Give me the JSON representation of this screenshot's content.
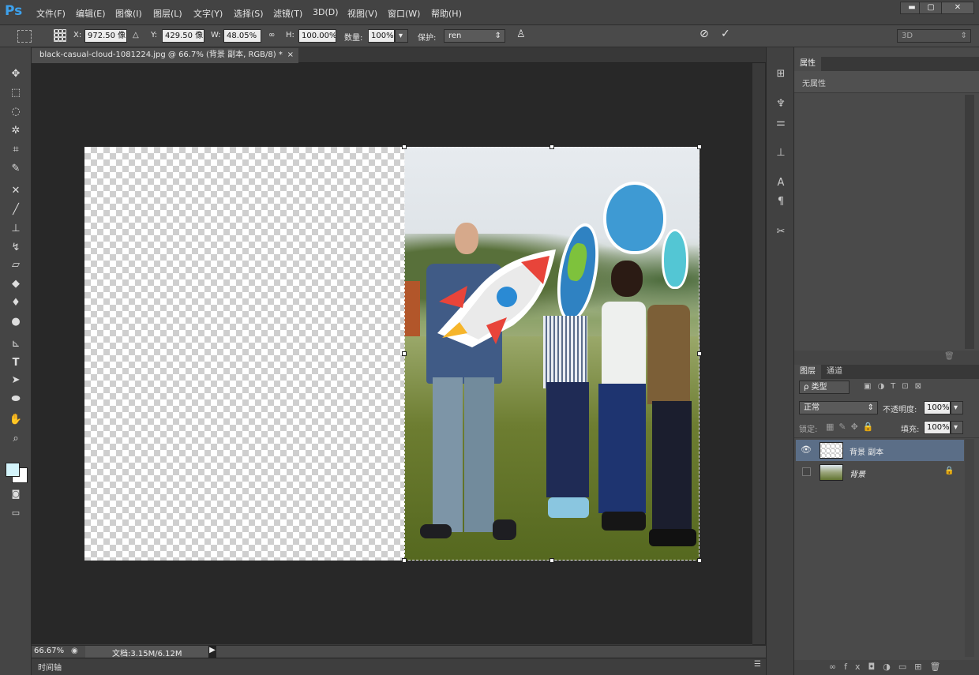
{
  "app": {
    "logo": "Ps",
    "colors": {
      "accent": "#3da1ec",
      "selected_layer": "#5b6e87"
    }
  },
  "menu": [
    "文件(F)",
    "编辑(E)",
    "图像(I)",
    "图层(L)",
    "文字(Y)",
    "选择(S)",
    "滤镜(T)",
    "3D(D)",
    "视图(V)",
    "窗口(W)",
    "帮助(H)"
  ],
  "window_buttons": {
    "minimize": "▬",
    "maximize": "▢",
    "close": "✕"
  },
  "options": {
    "x_label": "X:",
    "x_value": "972.50 像|",
    "y_label": "Y:",
    "y_value": "429.50 像|",
    "w_label": "W:",
    "w_value": "48.05%",
    "h_label": "H:",
    "h_value": "100.00%",
    "amount_label": "数量:",
    "amount_value": "100%",
    "protect_label": "保护:",
    "protect_value": "ren",
    "workspace": "3D"
  },
  "document": {
    "tab_title": "black-casual-cloud-1081224.jpg @ 66.7% (背景 副本, RGB/8) *",
    "close": "×"
  },
  "status": {
    "zoom": "66.67%",
    "doc_size": "文档:3.15M/6.12M"
  },
  "timeline": {
    "label": "时间轴"
  },
  "tools": [
    "move-icon",
    "marquee-icon",
    "lasso-icon",
    "magic-wand-icon",
    "crop-icon",
    "eyedropper-icon",
    "healing-icon",
    "brush-icon",
    "stamp-icon",
    "history-brush-icon",
    "eraser-icon",
    "bucket-icon",
    "blur-icon",
    "dodge-icon",
    "pen-icon",
    "type-icon",
    "path-select-icon",
    "ellipse-icon",
    "hand-icon",
    "zoom-icon"
  ],
  "properties": {
    "tab": "属性",
    "empty": "无属性"
  },
  "layers_panel": {
    "tab_layers": "图层",
    "tab_channels": "通道",
    "filter": "ρ 类型",
    "blend_mode": "正常",
    "opacity_label": "不透明度:",
    "opacity_value": "100%",
    "lock_label": "锁定:",
    "fill_label": "填充:",
    "fill_value": "100%",
    "layers": [
      {
        "name": "背景 副本",
        "visible": true,
        "selected": true,
        "locked": false
      },
      {
        "name": "背景",
        "visible": false,
        "selected": false,
        "locked": true
      }
    ]
  }
}
